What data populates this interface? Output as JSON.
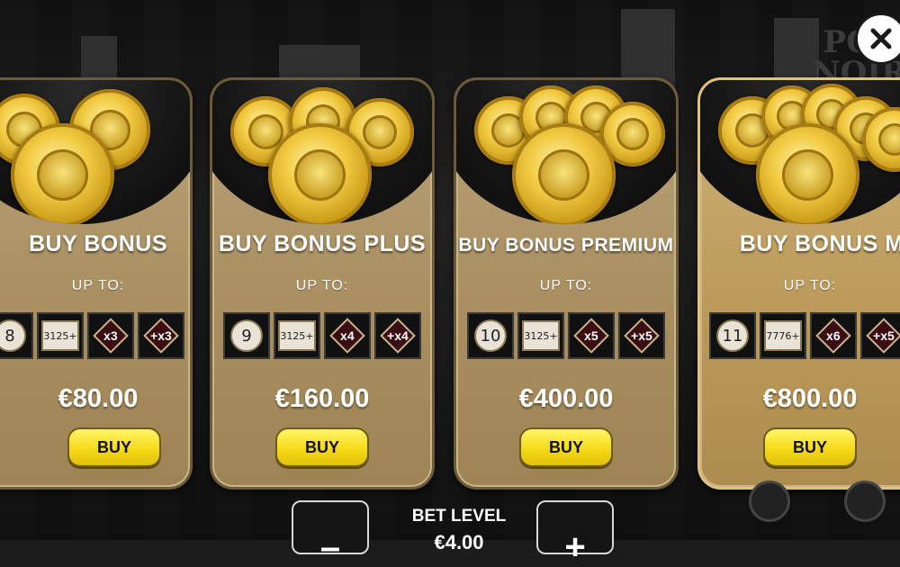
{
  "colors": {
    "buy_button": "#f5da18",
    "card_gold": "#a98f60",
    "price_text": "#ffffff"
  },
  "background": {
    "logo_text": "POP\nNOIR"
  },
  "close_icon": "close-x-icon",
  "cards": [
    {
      "title": "BUY BONUS",
      "up_to": "UP TO:",
      "features": {
        "ring": "8",
        "plaque": "3125+",
        "multiplier": "x3",
        "plus_multiplier": "+x3"
      },
      "price": "€80.00",
      "buy_label": "BUY"
    },
    {
      "title": "BUY BONUS PLUS",
      "up_to": "UP TO:",
      "features": {
        "ring": "9",
        "plaque": "3125+",
        "multiplier": "x4",
        "plus_multiplier": "+x4"
      },
      "price": "€160.00",
      "buy_label": "BUY"
    },
    {
      "title": "BUY BONUS PREMIUM",
      "up_to": "UP TO:",
      "features": {
        "ring": "10",
        "plaque": "3125+",
        "multiplier": "x5",
        "plus_multiplier": "+x5"
      },
      "price": "€400.00",
      "buy_label": "BUY"
    },
    {
      "title": "BUY BONUS MAX",
      "up_to": "UP TO:",
      "features": {
        "ring": "11",
        "plaque": "7776+",
        "multiplier": "x6",
        "plus_multiplier": "+x5"
      },
      "price": "€800.00",
      "buy_label": "BUY"
    }
  ],
  "bet": {
    "label": "BET LEVEL",
    "value": "€4.00",
    "decrease_icon": "minus-icon",
    "increase_icon": "plus-icon"
  }
}
